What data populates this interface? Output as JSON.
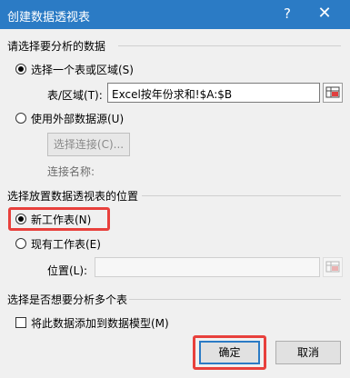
{
  "window": {
    "title": "创建数据透视表",
    "help_glyph": "?",
    "close_glyph": "✕"
  },
  "section_analyze": {
    "heading": "请选择要分析的数据",
    "option_table_range": {
      "label": "选择一个表或区域(S)",
      "checked": true
    },
    "table_range_field": {
      "label": "表/区域(T):",
      "value": "Excel按年份求和!$A:$B"
    },
    "option_external": {
      "label": "使用外部数据源(U)",
      "checked": false
    },
    "choose_connection_button": "选择连接(C)...",
    "connection_name_label": "连接名称:"
  },
  "section_location": {
    "heading": "选择放置数据透视表的位置",
    "option_new_sheet": {
      "label": "新工作表(N)",
      "checked": true
    },
    "option_existing_sheet": {
      "label": "现有工作表(E)",
      "checked": false
    },
    "location_field": {
      "label": "位置(L):",
      "value": ""
    }
  },
  "section_multi": {
    "heading": "选择是否想要分析多个表",
    "data_model_checkbox": {
      "label": "将此数据添加到数据模型(M)",
      "checked": false
    }
  },
  "buttons": {
    "ok": "确定",
    "cancel": "取消"
  },
  "colors": {
    "titlebar": "#2b7bc5",
    "highlight": "#e8403c"
  },
  "icons": {
    "range_selector": "range-select-icon"
  }
}
